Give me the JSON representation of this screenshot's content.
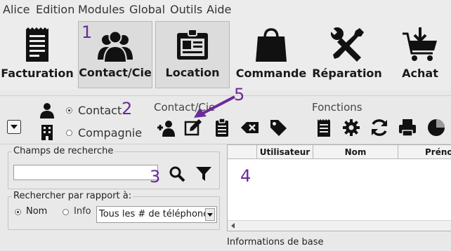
{
  "menu": [
    "Alice",
    "Edition",
    "Modules",
    "Global",
    "Outils",
    "Aide"
  ],
  "toolbar": {
    "items": [
      {
        "label": "Facturation",
        "icon": "invoice-icon"
      },
      {
        "label": "Contact/Cie",
        "icon": "people-group-icon"
      },
      {
        "label": "Location",
        "icon": "id-badge-icon"
      },
      {
        "label": "Commande",
        "icon": "shopping-bag-icon"
      },
      {
        "label": "Réparation",
        "icon": "tools-icon"
      },
      {
        "label": "Achat",
        "icon": "cart-download-icon"
      }
    ]
  },
  "annotations": {
    "n1": "1",
    "n2": "2",
    "n3": "3",
    "n4": "4",
    "n5": "5"
  },
  "mode": {
    "contact_label": "Contact",
    "company_label": "Compagnie",
    "selected": "Contact"
  },
  "sections": {
    "contact_cie_title": "Contact/Cie",
    "fonctions_title": "Fonctions"
  },
  "contact_actions": [
    "add-contact-icon",
    "edit-icon",
    "clipboard-icon",
    "delete-icon",
    "tag-icon"
  ],
  "function_actions": [
    "list-icon",
    "gear-icon",
    "refresh-icon",
    "print-icon",
    "pie-chart-icon"
  ],
  "search": {
    "group_title": "Champs de recherche",
    "value": "",
    "placeholder": ""
  },
  "filter": {
    "group_title": "Rechercher par rapport à:",
    "options": [
      {
        "label": "Nom",
        "selected": true
      },
      {
        "label": "Info",
        "selected": false
      }
    ],
    "phone_select": "Tous les # de téléphones"
  },
  "grid": {
    "columns": [
      "",
      "Utilisateur",
      "Nom",
      "Prénom"
    ]
  },
  "footer": {
    "info_label": "Informations de base"
  },
  "colors": {
    "annotation": "#6b2a9a",
    "background": "#e9e9e9"
  }
}
